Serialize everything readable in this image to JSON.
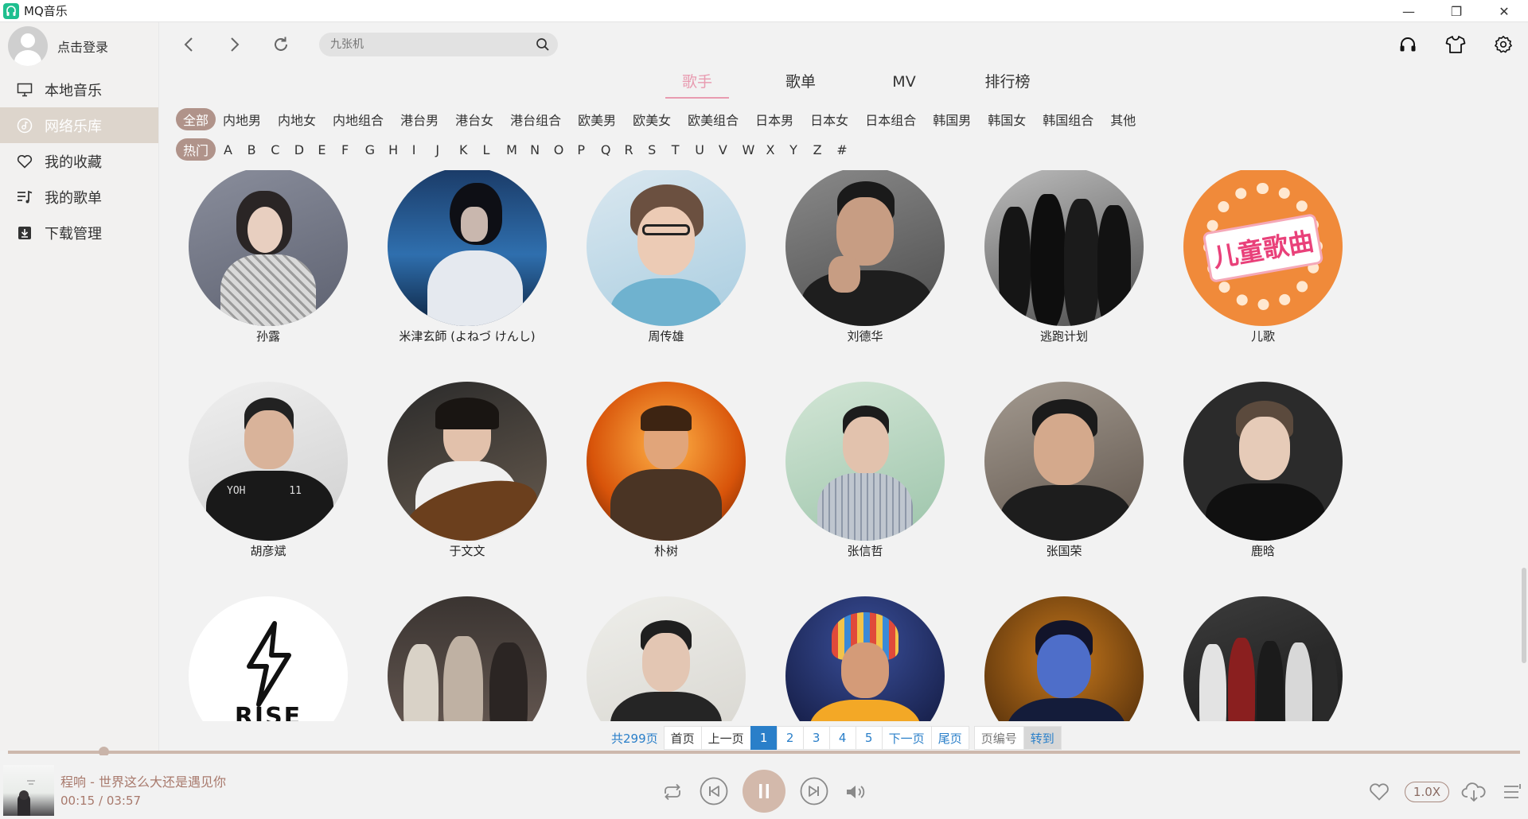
{
  "app": {
    "title": "MQ音乐"
  },
  "window": {
    "minimize": "—",
    "restore": "❐",
    "close": "✕"
  },
  "sidebar": {
    "login_label": "点击登录",
    "items": [
      {
        "label": "本地音乐",
        "icon": "monitor-icon"
      },
      {
        "label": "网络乐库",
        "icon": "music-disc-icon"
      },
      {
        "label": "我的收藏",
        "icon": "heart-icon"
      },
      {
        "label": "我的歌单",
        "icon": "playlist-icon"
      },
      {
        "label": "下载管理",
        "icon": "download-icon"
      }
    ]
  },
  "search": {
    "placeholder": "九张机"
  },
  "tabs": [
    "歌手",
    "歌单",
    "MV",
    "排行榜"
  ],
  "filters": {
    "categories": [
      "全部",
      "内地男",
      "内地女",
      "内地组合",
      "港台男",
      "港台女",
      "港台组合",
      "欧美男",
      "欧美女",
      "欧美组合",
      "日本男",
      "日本女",
      "日本组合",
      "韩国男",
      "韩国女",
      "韩国组合",
      "其他"
    ],
    "index": [
      "热门",
      "A",
      "B",
      "C",
      "D",
      "E",
      "F",
      "G",
      "H",
      "I",
      "J",
      "K",
      "L",
      "M",
      "N",
      "O",
      "P",
      "Q",
      "R",
      "S",
      "T",
      "U",
      "V",
      "W",
      "X",
      "Y",
      "Z",
      "#"
    ]
  },
  "artists": [
    {
      "name": "孙露"
    },
    {
      "name": "米津玄師 (よねづ けんし)"
    },
    {
      "name": "周传雄"
    },
    {
      "name": "刘德华"
    },
    {
      "name": "逃跑计划"
    },
    {
      "name": "儿歌",
      "badge": "儿童歌曲"
    },
    {
      "name": "胡彦斌"
    },
    {
      "name": "于文文"
    },
    {
      "name": "朴树"
    },
    {
      "name": "张信哲"
    },
    {
      "name": "张国荣"
    },
    {
      "name": "鹿晗"
    },
    {
      "name": "",
      "logo_text": "RISE"
    },
    {
      "name": ""
    },
    {
      "name": ""
    },
    {
      "name": ""
    },
    {
      "name": ""
    },
    {
      "name": ""
    }
  ],
  "pager": {
    "total": "共299页",
    "first": "首页",
    "prev": "上一页",
    "pages": [
      "1",
      "2",
      "3",
      "4",
      "5"
    ],
    "current": "1",
    "next": "下一页",
    "last": "尾页",
    "page_input_placeholder": "页编号",
    "go": "转到"
  },
  "player": {
    "song": "程响 - 世界这么大还是遇见你",
    "time": "00:15 / 03:57",
    "progress": 0.063,
    "speed": "1.0X"
  },
  "colors": {
    "accent_pink": "#e89bb0",
    "chip": "#b0938a",
    "pager_blue": "#2a7fc9",
    "player_brown": "#a8796c"
  }
}
